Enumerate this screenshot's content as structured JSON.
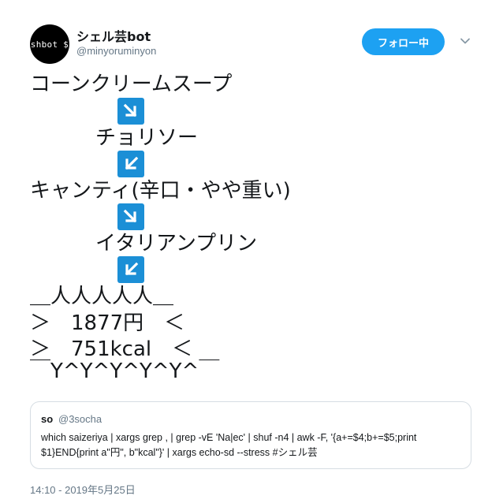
{
  "author": {
    "avatar_text": "shbot $",
    "display_name": "シェル芸bot",
    "handle": "@minyoruminyon"
  },
  "header": {
    "follow_label": "フォロー中",
    "menu_icon": "chevron-down-icon"
  },
  "tweet": {
    "lines": [
      "コーンクリームスープ",
      "チョリソー",
      "キャンティ(辛口・やや重い)",
      "イタリアンプリン",
      "＿人人人人人＿",
      "＞　1877円　＜",
      "＞　751kcal　＜",
      "￣Y^Y^Y^Y^Y^￣"
    ],
    "arrows": [
      "arrow-down-right-icon",
      "arrow-down-left-icon",
      "arrow-down-right-icon",
      "arrow-down-left-icon"
    ],
    "arrow_color": "#1b8fd6"
  },
  "quote": {
    "name": "so",
    "handle": "@3socha",
    "text_line1": "which saizeriya | xargs grep , | grep -vE 'Na|ec' | shuf -n4 | awk -F, '{a+=$4;b+=$5;print",
    "text_line2": "$1}END{print a\"円\", b\"kcal\"}' | xargs echo-sd --stress #シェル芸"
  },
  "timestamp": "14:10 - 2019年5月25日",
  "colors": {
    "accent": "#1da1f2",
    "muted": "#657786",
    "border": "#d6dde3"
  }
}
